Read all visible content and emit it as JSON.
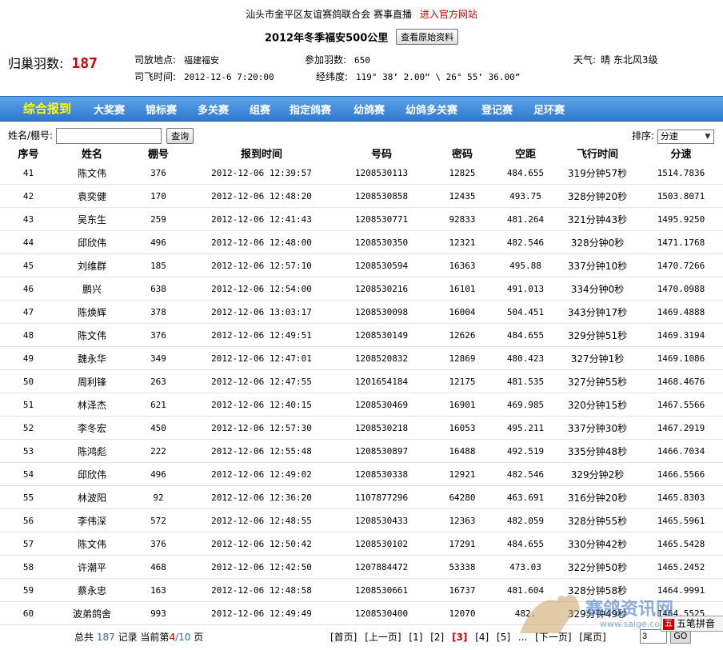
{
  "header": {
    "org": "汕头市金平区友谊赛鸽联合会",
    "live": "赛事直播",
    "official_link": "进入官方网站",
    "race_title": "2012年冬季福安500公里",
    "view_raw_button": "查看原始资料"
  },
  "summary": {
    "homing_label": "归巢羽数:",
    "homing_count": "187",
    "release_place_label": "司放地点:",
    "release_place": "福建福安",
    "participants_label": "参加羽数:",
    "participants": "650",
    "weather_label": "天气:",
    "weather": "晴 东北风3级",
    "release_time_label": "司飞时间:",
    "release_time": "2012-12-6 7:20:00",
    "coords_label": "经纬度:",
    "coords": "119° 38’ 2.00” \\ 26° 55’ 36.00”"
  },
  "nav": [
    "综合报到",
    "大奖赛",
    "锦标赛",
    "多关赛",
    "组赛",
    "指定鸽赛",
    "幼鸽赛",
    "幼鸽多关赛",
    "登记赛",
    "足环赛"
  ],
  "search": {
    "label": "姓名/棚号:",
    "value": "",
    "button": "查询",
    "sort_label": "排序:",
    "sort_value": "分速"
  },
  "table": {
    "columns": [
      "序号",
      "姓名",
      "棚号",
      "报到时间",
      "号码",
      "密码",
      "空距",
      "飞行时间",
      "分速"
    ],
    "rows": [
      [
        "41",
        "陈文伟",
        "376",
        "2012-12-06 12:39:57",
        "1208530113",
        "12825",
        "484.655",
        "319分钟57秒",
        "1514.7836"
      ],
      [
        "42",
        "袁奕健",
        "170",
        "2012-12-06 12:48:20",
        "1208530858",
        "12435",
        "493.75",
        "328分钟20秒",
        "1503.8071"
      ],
      [
        "43",
        "吴东生",
        "259",
        "2012-12-06 12:41:43",
        "1208530771",
        "92833",
        "481.264",
        "321分钟43秒",
        "1495.9250"
      ],
      [
        "44",
        "邱欣伟",
        "496",
        "2012-12-06 12:48:00",
        "1208530350",
        "12321",
        "482.546",
        "328分钟0秒",
        "1471.1768"
      ],
      [
        "45",
        "刘维群",
        "185",
        "2012-12-06 12:57:10",
        "1208530594",
        "16363",
        "495.88",
        "337分钟10秒",
        "1470.7266"
      ],
      [
        "46",
        "鹏兴",
        "638",
        "2012-12-06 12:54:00",
        "1208530216",
        "16101",
        "491.013",
        "334分钟0秒",
        "1470.0988"
      ],
      [
        "47",
        "陈焕辉",
        "378",
        "2012-12-06 13:03:17",
        "1208530098",
        "16004",
        "504.451",
        "343分钟17秒",
        "1469.4888"
      ],
      [
        "48",
        "陈文伟",
        "376",
        "2012-12-06 12:49:51",
        "1208530149",
        "12626",
        "484.655",
        "329分钟51秒",
        "1469.3194"
      ],
      [
        "49",
        "魏永华",
        "349",
        "2012-12-06 12:47:01",
        "1208520832",
        "12869",
        "480.423",
        "327分钟1秒",
        "1469.1086"
      ],
      [
        "50",
        "周利锋",
        "263",
        "2012-12-06 12:47:55",
        "1201654184",
        "12175",
        "481.535",
        "327分钟55秒",
        "1468.4676"
      ],
      [
        "51",
        "林泽杰",
        "621",
        "2012-12-06 12:40:15",
        "1208530469",
        "16901",
        "469.985",
        "320分钟15秒",
        "1467.5566"
      ],
      [
        "52",
        "李冬宏",
        "450",
        "2012-12-06 12:57:30",
        "1208530218",
        "16053",
        "495.211",
        "337分钟30秒",
        "1467.2919"
      ],
      [
        "53",
        "陈鸿彪",
        "222",
        "2012-12-06 12:55:48",
        "1208530897",
        "16488",
        "492.519",
        "335分钟48秒",
        "1466.7034"
      ],
      [
        "54",
        "邱欣伟",
        "496",
        "2012-12-06 12:49:02",
        "1208530338",
        "12921",
        "482.546",
        "329分钟2秒",
        "1466.5566"
      ],
      [
        "55",
        "林波阳",
        "92",
        "2012-12-06 12:36:20",
        "1107877296",
        "64280",
        "463.691",
        "316分钟20秒",
        "1465.8303"
      ],
      [
        "56",
        "李伟深",
        "572",
        "2012-12-06 12:48:55",
        "1208530433",
        "12363",
        "482.059",
        "328分钟55秒",
        "1465.5961"
      ],
      [
        "57",
        "陈文伟",
        "376",
        "2012-12-06 12:50:42",
        "1208530102",
        "17291",
        "484.655",
        "330分钟42秒",
        "1465.5428"
      ],
      [
        "58",
        "许潮平",
        "468",
        "2012-12-06 12:42:50",
        "1207884472",
        "53338",
        "473.03",
        "322分钟50秒",
        "1465.2452"
      ],
      [
        "59",
        "蔡永忠",
        "163",
        "2012-12-06 12:48:58",
        "1208530661",
        "16737",
        "481.604",
        "328分钟58秒",
        "1464.9991"
      ],
      [
        "60",
        "波弟鸽舍",
        "993",
        "2012-12-06 12:49:49",
        "1208530400",
        "12070",
        "482.",
        "329分钟49秒",
        "1464.5525"
      ]
    ]
  },
  "footer": {
    "total_prefix": "总共",
    "total": "187",
    "records": "记录",
    "current_label": "当前第",
    "current_page": "4",
    "page_total": "/10",
    "page_suffix": "页",
    "pager": [
      "[首页]",
      "[上一页]",
      "[1]",
      "[2]",
      "[3]",
      "[4]",
      "[5]",
      "...",
      "[下一页]",
      "[尾页]"
    ],
    "jump_value": "3",
    "go_button": "GO"
  },
  "watermark": {
    "text": "赛鸽资讯网",
    "url": "www.saige.com"
  },
  "ime": {
    "label": "五笔拼音"
  }
}
